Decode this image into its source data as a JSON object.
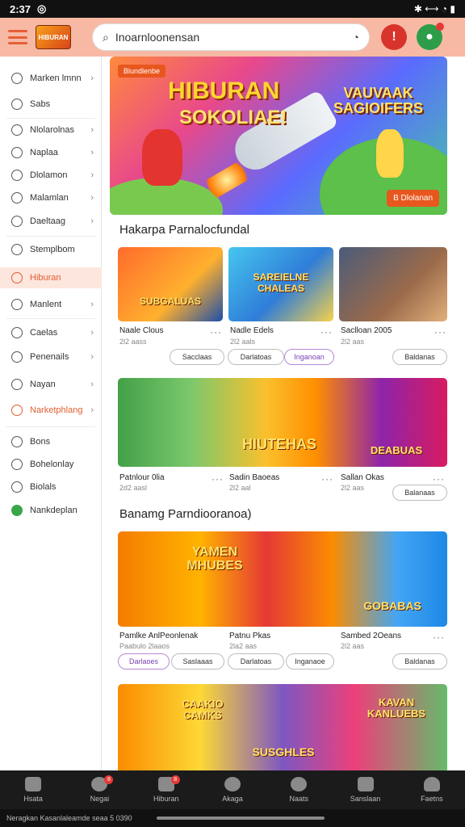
{
  "status": {
    "time": "2:37",
    "icons": "✱ ⟷ ◔ ▮"
  },
  "appbar": {
    "logo": "HIBURAN",
    "search_value": "Inoarnloonensan"
  },
  "sidebar": {
    "items": [
      {
        "label": "Marken lmnn"
      },
      {
        "label": "Sabs"
      },
      {
        "label": "Nlolarolnas"
      },
      {
        "label": "Naplaa"
      },
      {
        "label": "Dlolamon"
      },
      {
        "label": "Malamlan"
      },
      {
        "label": "Daeltaag"
      },
      {
        "label": "Stemplbom"
      },
      {
        "label": "Hiburan"
      },
      {
        "label": "Manlent"
      },
      {
        "label": "Caelas"
      },
      {
        "label": "Penenails"
      },
      {
        "label": "Nayan"
      },
      {
        "label": "Narketphlang"
      },
      {
        "label": "Bons"
      },
      {
        "label": "Bohelonlay"
      },
      {
        "label": "Biolals"
      },
      {
        "label": "Nankdeplan"
      }
    ]
  },
  "hero": {
    "badge": "Blundlenbe",
    "title1": "HIBURAN",
    "title2": "SOKOLIAE!",
    "title3": "VAUVAAK\nSAGIOIFERS",
    "cta": "B Dlolanan"
  },
  "section1": {
    "title": "Hakarpa Parnalocfundal",
    "cards": [
      {
        "thumb": "SUBGALUAS",
        "label": "Naale Clous",
        "sub": "2l2 aass"
      },
      {
        "thumb": "SAREIELNE CHALEAS",
        "label": "Nadle Edels",
        "sub": "2l2 aals"
      },
      {
        "thumb": "",
        "label": "Saclloan 2005",
        "sub": "2l2 aas"
      }
    ],
    "chips": [
      "Sacclaas",
      "Darlatoas",
      "Inganoan",
      "Baldanas"
    ]
  },
  "section2": {
    "cards": [
      {
        "label": "Patnlour 0lia",
        "sub": "2d2 aasl"
      },
      {
        "label": "Sadin Baoeas",
        "sub": "2l2 aal"
      },
      {
        "label": "Sallan Okas",
        "sub": "2l2 aas"
      }
    ],
    "banner_left": "HIUTEHAS",
    "banner_right": "DEABUAS",
    "chip": "Balanaas"
  },
  "section3": {
    "title": "Banamg Parndiooranoa)",
    "cards": [
      {
        "label": "Pamlke AnlPeonlenak",
        "sub": "Paabulo 2laaos"
      },
      {
        "label": "Patnu Pkas",
        "sub": "2la2 aas"
      },
      {
        "label": "Sambed 2Oeans",
        "sub": "2l2 aas"
      }
    ],
    "banner_left": "YAMEN MHUBES",
    "banner_right": "GOBABAS",
    "chips": [
      "Darlaoes",
      "Saslaaas",
      "Darlatoas",
      "Inganaoe",
      "Baldanas"
    ]
  },
  "section4": {
    "banner_left": "CAAKIO CAMKS",
    "banner_center": "SUSGHLES",
    "banner_right": "KAVAN KANLUEBS"
  },
  "bottomnav": [
    {
      "label": "Hsata",
      "badge": ""
    },
    {
      "label": "Negai",
      "badge": "8"
    },
    {
      "label": "Hiburan",
      "badge": "8"
    },
    {
      "label": "Akaga",
      "badge": ""
    },
    {
      "label": "Naats",
      "badge": ""
    },
    {
      "label": "Sanslaan",
      "badge": ""
    },
    {
      "label": "Faetns",
      "badge": ""
    }
  ],
  "footer": "Neragkan Kasanlaleamde seaa 5 0390"
}
